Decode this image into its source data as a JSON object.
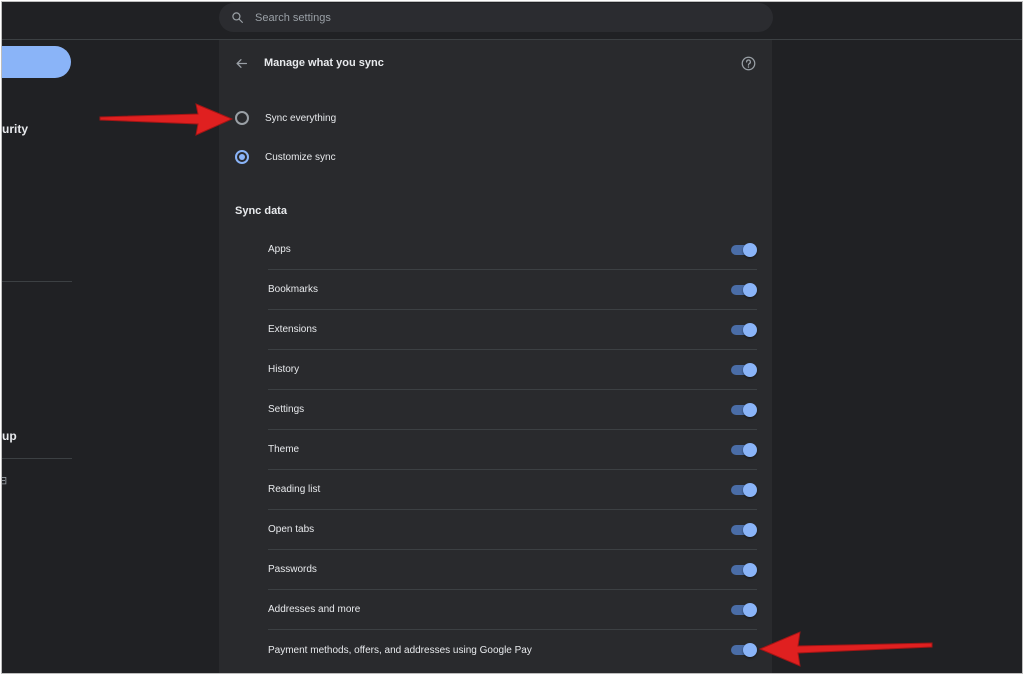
{
  "search": {
    "placeholder": "Search settings"
  },
  "sidebar": {
    "items": [
      {
        "label": "urity"
      },
      {
        "label": "up"
      }
    ],
    "glyph": "⊟"
  },
  "page": {
    "title": "Manage what you sync"
  },
  "sync_options": [
    {
      "label": "Sync everything",
      "selected": false
    },
    {
      "label": "Customize sync",
      "selected": true
    }
  ],
  "sync_data": {
    "title": "Sync data",
    "items": [
      {
        "label": "Apps",
        "enabled": true
      },
      {
        "label": "Bookmarks",
        "enabled": true
      },
      {
        "label": "Extensions",
        "enabled": true
      },
      {
        "label": "History",
        "enabled": true
      },
      {
        "label": "Settings",
        "enabled": true
      },
      {
        "label": "Theme",
        "enabled": true
      },
      {
        "label": "Reading list",
        "enabled": true
      },
      {
        "label": "Open tabs",
        "enabled": true
      },
      {
        "label": "Passwords",
        "enabled": true
      },
      {
        "label": "Addresses and more",
        "enabled": true
      },
      {
        "label": "Payment methods, offers, and addresses using Google Pay",
        "enabled": true
      }
    ]
  },
  "colors": {
    "accent": "#8ab4f8",
    "background": "#202124",
    "panel": "#292a2d",
    "annotation_arrow": "#e02020"
  },
  "icons": [
    "search-icon",
    "back-arrow-icon",
    "help-icon"
  ]
}
